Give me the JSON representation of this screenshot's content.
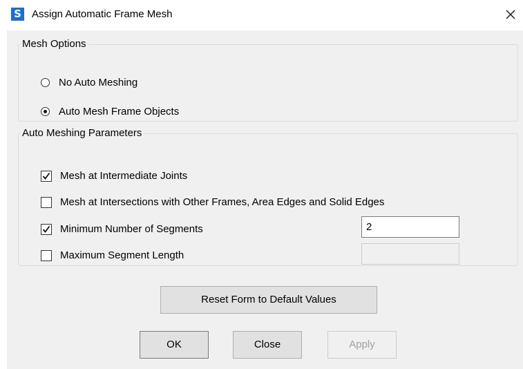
{
  "window": {
    "title": "Assign Automatic Frame Mesh",
    "logo_letter": "S",
    "logo_color": "#1d6fcf",
    "close_icon": "close-icon"
  },
  "mesh_options": {
    "legend": "Mesh Options",
    "options": [
      {
        "label": "No Auto Meshing",
        "selected": false
      },
      {
        "label": "Auto Mesh Frame Objects",
        "selected": true
      }
    ]
  },
  "auto_meshing_parameters": {
    "legend": "Auto Meshing Parameters",
    "intermediate_joints": {
      "label": "Mesh at Intermediate Joints",
      "checked": true
    },
    "intersections": {
      "label": "Mesh at Intersections with Other Frames, Area Edges and Solid Edges",
      "checked": false
    },
    "min_segments": {
      "label": "Minimum Number of Segments",
      "checked": true,
      "value": "2"
    },
    "max_segment_length": {
      "label": "Maximum Segment Length",
      "checked": false,
      "value": "",
      "enabled": false
    }
  },
  "buttons": {
    "reset": "Reset Form to Default Values",
    "ok": "OK",
    "close": "Close",
    "apply": "Apply",
    "apply_enabled": false
  }
}
